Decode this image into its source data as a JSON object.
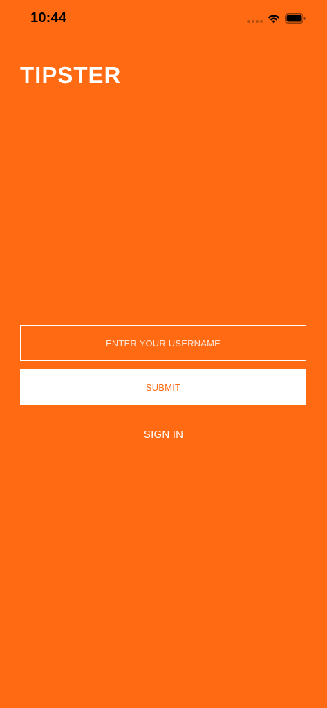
{
  "status_bar": {
    "time": "10:44",
    "icons": [
      "signal-dots-icon",
      "wifi-icon",
      "battery-icon"
    ]
  },
  "app": {
    "title": "TIPSTER"
  },
  "login_form": {
    "username_placeholder": "ENTER YOUR USERNAME",
    "username_value": "",
    "submit_label": "SUBMIT",
    "sign_in_label": "SIGN IN"
  },
  "colors": {
    "background": "#ff6a13",
    "foreground": "#ffffff"
  }
}
